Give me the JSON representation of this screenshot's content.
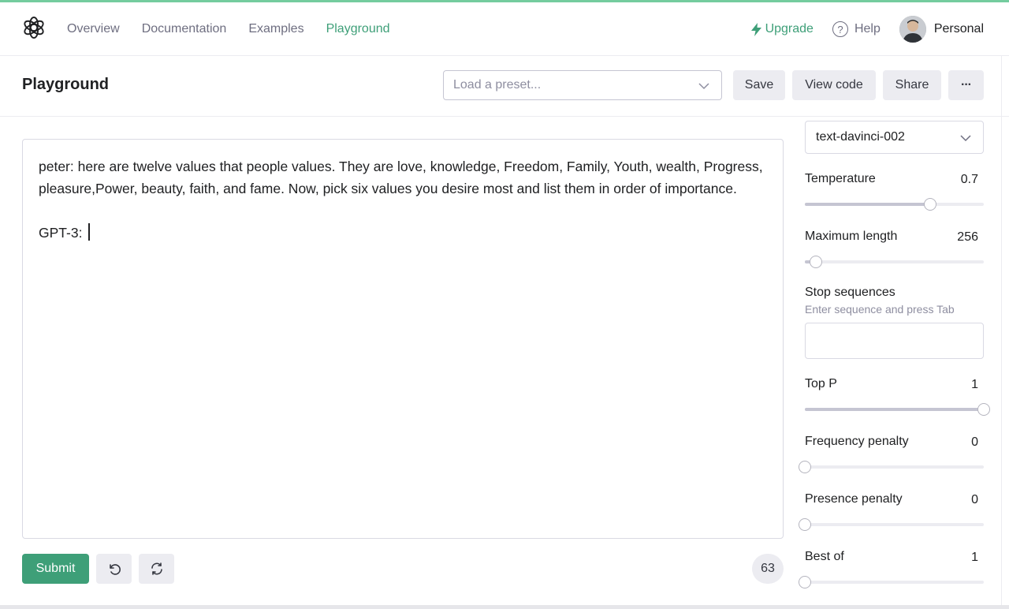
{
  "nav": {
    "items": [
      {
        "label": "Overview",
        "active": false
      },
      {
        "label": "Documentation",
        "active": false
      },
      {
        "label": "Examples",
        "active": false
      },
      {
        "label": "Playground",
        "active": true
      }
    ],
    "upgrade_label": "Upgrade",
    "help_label": "Help",
    "help_glyph": "?",
    "profile_label": "Personal"
  },
  "header": {
    "title": "Playground",
    "preset_placeholder": "Load a preset...",
    "save_label": "Save",
    "view_code_label": "View code",
    "share_label": "Share",
    "more_label": "···"
  },
  "editor": {
    "text": "peter: here are twelve values that people values. They are love, knowledge, Freedom, Family, Youth, wealth, Progress, pleasure,Power, beauty, faith, and fame. Now, pick six values you desire most and list them in order of importance.\n\nGPT-3: "
  },
  "footer": {
    "submit_label": "Submit",
    "token_count": "63"
  },
  "sidebar": {
    "model": "text-davinci-002",
    "temperature": {
      "label": "Temperature",
      "value": "0.7",
      "fraction": 0.7
    },
    "max_length": {
      "label": "Maximum length",
      "value": "256",
      "fraction": 0.06
    },
    "stop_sequences": {
      "label": "Stop sequences",
      "hint": "Enter sequence and press Tab"
    },
    "top_p": {
      "label": "Top P",
      "value": "1",
      "fraction": 1.0
    },
    "frequency_penalty": {
      "label": "Frequency penalty",
      "value": "0",
      "fraction": 0.0
    },
    "presence_penalty": {
      "label": "Presence penalty",
      "value": "0",
      "fraction": 0.0
    },
    "best_of": {
      "label": "Best of",
      "value": "1",
      "fraction": 0.0
    }
  },
  "colors": {
    "accent": "#3e9f78",
    "top_stripe": "#74cc9e"
  }
}
